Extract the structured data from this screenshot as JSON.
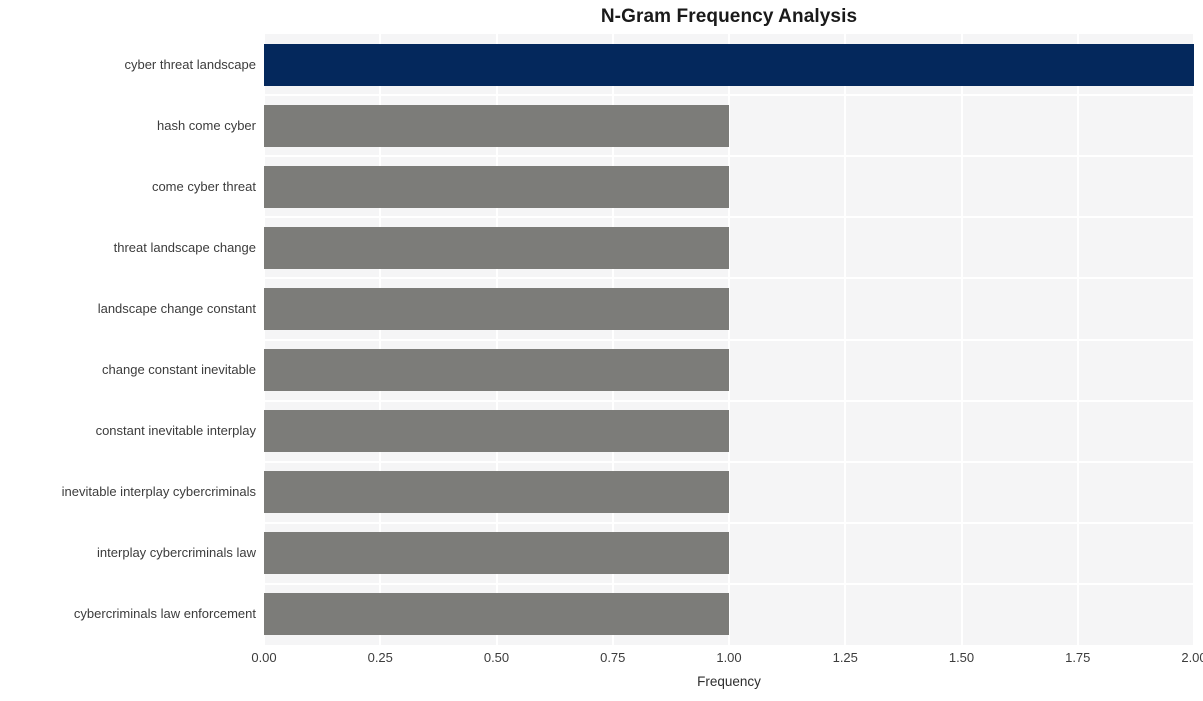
{
  "chart_data": {
    "type": "bar",
    "orientation": "horizontal",
    "title": "N-Gram Frequency Analysis",
    "xlabel": "Frequency",
    "ylabel": "",
    "categories": [
      "cyber threat landscape",
      "hash come cyber",
      "come cyber threat",
      "threat landscape change",
      "landscape change constant",
      "change constant inevitable",
      "constant inevitable interplay",
      "inevitable interplay cybercriminals",
      "interplay cybercriminals law",
      "cybercriminals law enforcement"
    ],
    "values": [
      2,
      1,
      1,
      1,
      1,
      1,
      1,
      1,
      1,
      1
    ],
    "xlim": [
      0,
      2
    ],
    "xticks": [
      0,
      0.25,
      0.5,
      0.75,
      1.0,
      1.25,
      1.5,
      1.75,
      2.0
    ],
    "xtick_labels": [
      "0.00",
      "0.25",
      "0.50",
      "0.75",
      "1.00",
      "1.25",
      "1.50",
      "1.75",
      "2.00"
    ],
    "grid": true,
    "legend": null,
    "bar_colors": [
      "#04285c",
      "#7c7c79",
      "#7c7c79",
      "#7c7c79",
      "#7c7c79",
      "#7c7c79",
      "#7c7c79",
      "#7c7c79",
      "#7c7c79",
      "#7c7c79"
    ],
    "highlight_color": "#04285c",
    "base_color": "#7c7c79",
    "plot_background": "#f5f5f6",
    "grid_color": "#ffffff",
    "figure_background": "#ffffff"
  }
}
